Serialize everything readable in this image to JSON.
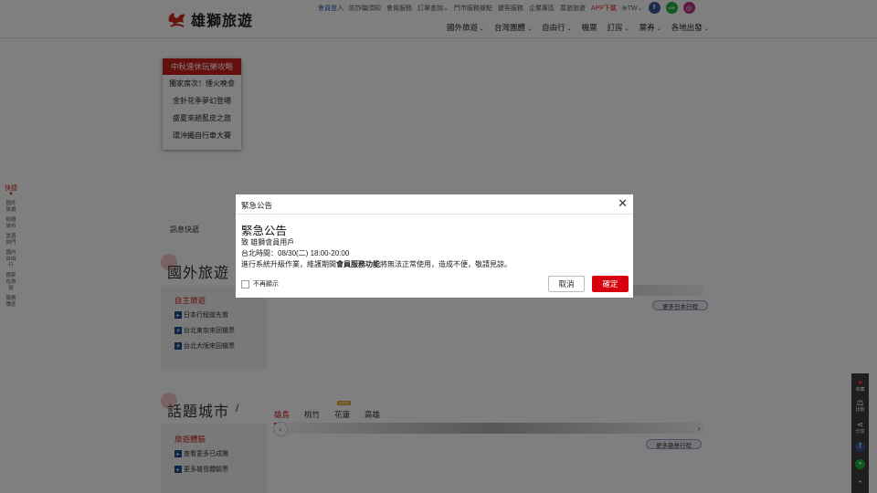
{
  "header": {
    "logo_text": "雄獅旅遊",
    "top_links": [
      "會員登入",
      "防詐騙須知",
      "會員服務",
      "訂單查詢",
      "門市服務據點",
      "鍵客服務",
      "企業專區",
      "尊旅旅遊",
      "APP下載"
    ],
    "lang": "TW",
    "main_nav": [
      "國外旅遊",
      "台灣團體",
      "自由行",
      "機票",
      "訂房",
      "票券",
      "各地出發"
    ],
    "line_label": "LINE"
  },
  "quickbar": {
    "title": "快捷",
    "items": [
      "國外旅遊",
      "話題城市",
      "當週熱門",
      "國內自由行",
      "國家在旅遊",
      "服務專區"
    ]
  },
  "promo": {
    "title": "中秋連休玩樂攻略",
    "items": [
      "獨家席次！煙火晚會",
      "金針花季夢幻登場",
      "盛夏來趟藍皮之旅",
      "環沖繩自行車大賽"
    ]
  },
  "news_label": "訊息快遞",
  "section_international": {
    "title": "國外旅遊",
    "panel_title": "自主旅遊",
    "links": [
      "日本行程搶先看",
      "台北東京來回機票",
      "台北大阪來回機票"
    ],
    "more": "更多日本行程"
  },
  "section_cities": {
    "title": "話題城市",
    "tabs": [
      "雄島",
      "桃竹",
      "花蓮",
      "高雄"
    ],
    "new_badge": "NEW",
    "panel_title": "旅遊體驗",
    "links": [
      "查看更多已成團",
      "更多雄島體驗票"
    ],
    "more": "更多雄島行程"
  },
  "right_bar": [
    "收藏",
    "比較",
    "分享",
    "",
    ""
  ],
  "dialog": {
    "header_title": "緊急公告",
    "title": "緊急公告",
    "line1": "致 雄獅會員用戶",
    "line2": "台北時間：08/30(二) 18:00-20:00",
    "line3_pre": "進行系統升級作業，維護期間",
    "line3_bold": "會員服務功能",
    "line3_post": "將無法正常使用，造成不便，敬請見諒。",
    "dont_show": "不再顯示",
    "cancel": "取消",
    "confirm": "確定"
  },
  "colors": {
    "brand_red": "#c8201c",
    "confirm_red": "#d7000f",
    "overlay": "rgba(0,0,0,0.5)"
  }
}
